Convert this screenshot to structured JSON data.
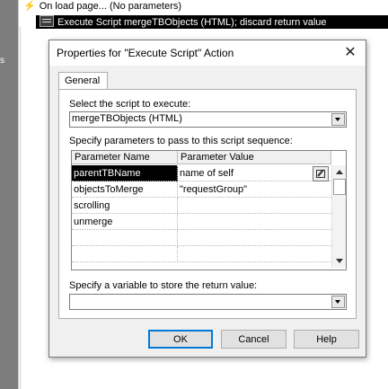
{
  "background": {
    "left_label": "s",
    "tree": {
      "onload_label": "On load page... (No parameters)",
      "script_line": "Execute Script mergeTBObjects (HTML); discard return value"
    }
  },
  "dialog": {
    "title": "Properties for \"Execute Script\" Action",
    "close_glyph": "✕",
    "tab_general": "General",
    "select_script_label": "Select the script to execute:",
    "script_value": "mergeTBObjects (HTML)",
    "params_label": "Specify parameters to pass to this script sequence:",
    "grid": {
      "columns": [
        "Parameter Name",
        "Parameter Value"
      ],
      "rows": [
        {
          "name": "parentTBName",
          "value": "name of self"
        },
        {
          "name": "objectsToMerge",
          "value": "\"requestGroup\""
        },
        {
          "name": "scrolling",
          "value": ""
        },
        {
          "name": "unmerge",
          "value": ""
        },
        {
          "name": "",
          "value": ""
        },
        {
          "name": "",
          "value": ""
        }
      ]
    },
    "variable_label": "Specify a variable to store the return value:",
    "variable_value": "",
    "buttons": {
      "ok": "OK",
      "cancel": "Cancel",
      "help": "Help"
    }
  },
  "colors": {
    "selection": "#000000",
    "default_button_border": "#0078d7",
    "strip": "#7d7d7d"
  }
}
